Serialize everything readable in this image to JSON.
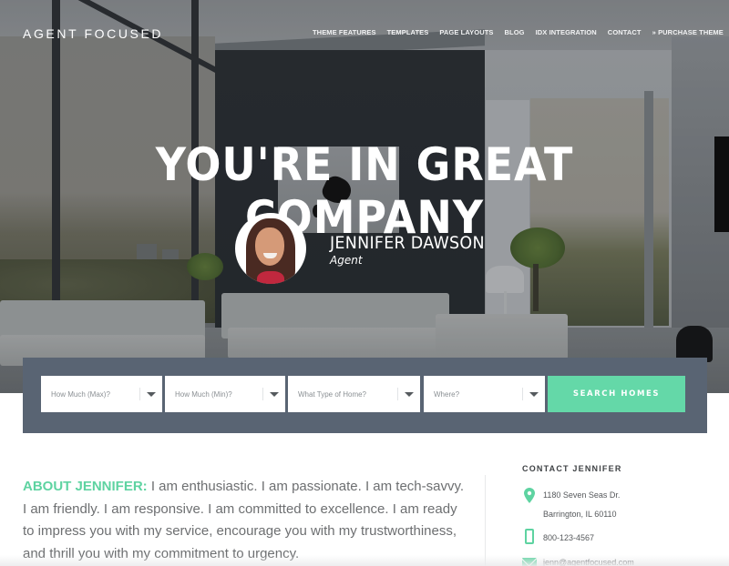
{
  "header": {
    "site_title": "AGENT FOCUSED",
    "nav": [
      {
        "label": "THEME FEATURES"
      },
      {
        "label": "TEMPLATES"
      },
      {
        "label": "PAGE LAYOUTS"
      },
      {
        "label": "BLOG"
      },
      {
        "label": "IDX INTEGRATION"
      },
      {
        "label": "CONTACT"
      },
      {
        "label": "» PURCHASE THEME"
      }
    ]
  },
  "hero": {
    "headline": "YOU'RE IN GREAT COMPANY",
    "agent": {
      "name": "JENNIFER DAWSON",
      "role": "Agent",
      "photo_icon": "agent-portrait"
    }
  },
  "search": {
    "fields": [
      {
        "placeholder": "How Much (Max)?",
        "icon": "caret-down-icon"
      },
      {
        "placeholder": "How Much (Min)?",
        "icon": "caret-down-icon"
      },
      {
        "placeholder": "What Type of Home?",
        "icon": "caret-down-icon"
      },
      {
        "placeholder": "Where?",
        "icon": "caret-down-icon"
      }
    ],
    "button_label": "SEARCH HOMES",
    "accent_color": "#64d8a8",
    "panel_color": "#596473"
  },
  "about": {
    "lead": "ABOUT JENNIFER:",
    "text": " I am enthusiastic. I am passionate. I am tech-savvy. I am friendly. I am responsive. I am committed to excellence. I am ready to impress you with my service, encourage you with my trustworthiness, and thrill you with my commitment to urgency."
  },
  "contact": {
    "title": "CONTACT JENNIFER",
    "address_line1": "1180 Seven Seas Dr.",
    "address_line2": "Barrington, IL 60110",
    "phone": "800-123-4567",
    "email": "jenn@agentfocused.com",
    "icons": [
      "map-pin-icon",
      "phone-icon",
      "mail-icon"
    ]
  }
}
